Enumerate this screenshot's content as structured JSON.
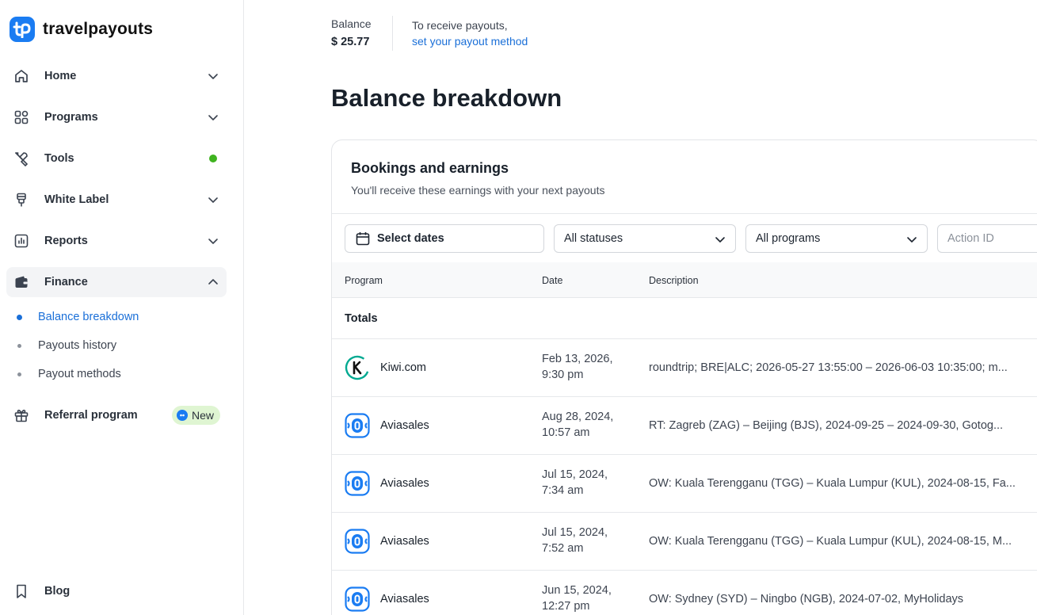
{
  "brand": {
    "name": "travelpayouts",
    "color": "#1a7cf2"
  },
  "sidebar": {
    "items": [
      {
        "label": "Home",
        "icon": "home-icon",
        "has_chevron": true
      },
      {
        "label": "Programs",
        "icon": "grid-icon",
        "has_chevron": true
      },
      {
        "label": "Tools",
        "icon": "tools-icon",
        "status_dot": "#3fb31f"
      },
      {
        "label": "White Label",
        "icon": "plug-icon",
        "has_chevron": true
      },
      {
        "label": "Reports",
        "icon": "chart-icon",
        "has_chevron": true
      },
      {
        "label": "Finance",
        "icon": "wallet-icon",
        "expanded": true
      },
      {
        "label": "Referral program",
        "icon": "gift-icon",
        "badge": "New"
      },
      {
        "label": "Blog",
        "icon": "bookmark-icon"
      }
    ],
    "finance_sub": [
      {
        "label": "Balance breakdown",
        "active": true
      },
      {
        "label": "Payouts history"
      },
      {
        "label": "Payout methods"
      }
    ]
  },
  "header": {
    "balance_label": "Balance",
    "balance_value": "$ 25.77",
    "payout_text": "To receive payouts,",
    "payout_link": "set your payout method"
  },
  "page_title": "Balance breakdown",
  "card": {
    "title": "Bookings and earnings",
    "subtitle": "You'll receive these earnings with your next payouts",
    "filters": {
      "dates": "Select dates",
      "statuses": "All statuses",
      "programs": "All programs",
      "action_id_placeholder": "Action ID"
    },
    "columns": [
      "Program",
      "Date",
      "Description"
    ],
    "totals_label": "Totals",
    "rows": [
      {
        "program": "Kiwi.com",
        "logo": "kiwi-logo-icon",
        "date_line1": "Feb 13, 2026,",
        "date_line2": "9:30 pm",
        "description": "roundtrip; BRE|ALC; 2026-05-27 13:55:00 – 2026-06-03 10:35:00; m..."
      },
      {
        "program": "Aviasales",
        "logo": "aviasales-logo-icon",
        "date_line1": "Aug 28, 2024,",
        "date_line2": "10:57 am",
        "description": "RT: Zagreb (ZAG) – Beijing (BJS), 2024-09-25 – 2024-09-30, Gotog..."
      },
      {
        "program": "Aviasales",
        "logo": "aviasales-logo-icon",
        "date_line1": "Jul 15, 2024,",
        "date_line2": "7:34 am",
        "description": "OW: Kuala Terengganu (TGG) – Kuala Lumpur (KUL), 2024-08-15, Fa..."
      },
      {
        "program": "Aviasales",
        "logo": "aviasales-logo-icon",
        "date_line1": "Jul 15, 2024,",
        "date_line2": "7:52 am",
        "description": "OW: Kuala Terengganu (TGG) – Kuala Lumpur (KUL), 2024-08-15, M..."
      },
      {
        "program": "Aviasales",
        "logo": "aviasales-logo-icon",
        "date_line1": "Jun 15, 2024,",
        "date_line2": "12:27 pm",
        "description": "OW: Sydney (SYD) – Ningbo (NGB), 2024-07-02, MyHolidays"
      }
    ]
  },
  "colors": {
    "link": "#1a6fd8",
    "kiwi": "#00a991",
    "aviasales": "#1a7cf2"
  }
}
